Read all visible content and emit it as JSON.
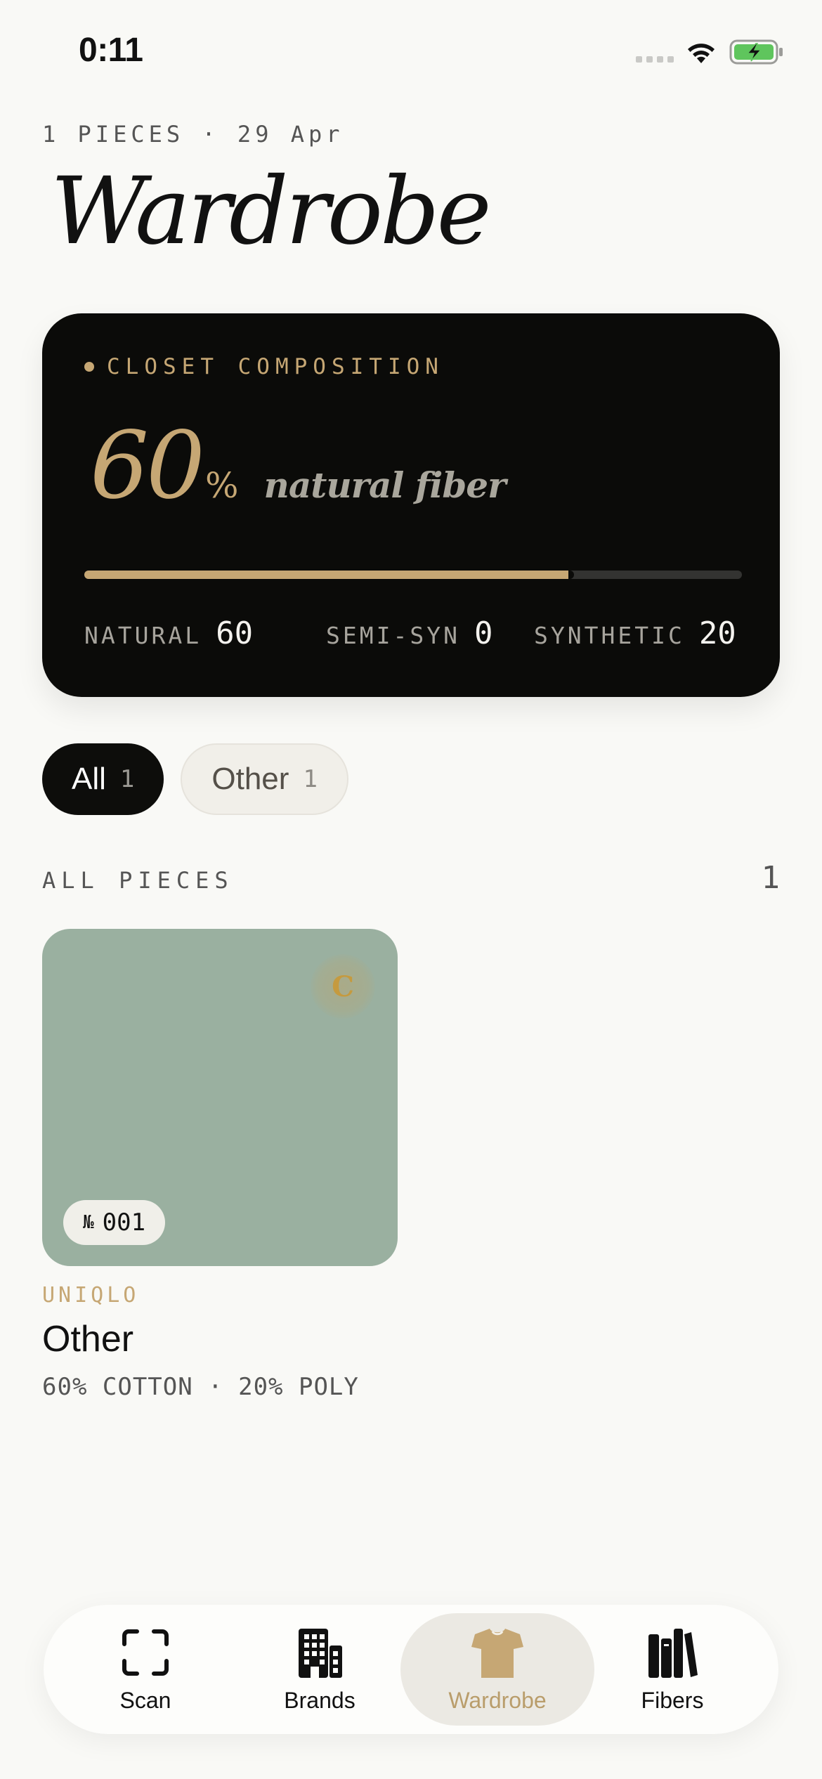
{
  "status_bar": {
    "time": "0:11"
  },
  "header": {
    "meta": "1 PIECES · 29 Apr",
    "title": "Wardrobe"
  },
  "composition": {
    "label": "CLOSET COMPOSITION",
    "percent_value": "60",
    "percent_sign": "%",
    "caption": "natural fiber",
    "natural_fraction": 0.745,
    "stats": [
      {
        "label": "NATURAL",
        "value": "60"
      },
      {
        "label": "SEMI-SYN",
        "value": "0"
      },
      {
        "label": "SYNTHETIC",
        "value": "20"
      }
    ],
    "colors": {
      "accent": "#c6a774",
      "card": "#0b0b09",
      "track": "#333331"
    }
  },
  "filters": [
    {
      "label": "All",
      "count": "1",
      "active": true
    },
    {
      "label": "Other",
      "count": "1",
      "active": false
    }
  ],
  "section": {
    "label": "ALL PIECES",
    "count": "1"
  },
  "items": [
    {
      "badge": "C",
      "number_sign": "№",
      "number": "001",
      "brand": "UNIQLO",
      "name": "Other",
      "composition": "60% COTTON · 20% POLY",
      "swatch_color": "#9ab0a0"
    }
  ],
  "tab_bar": {
    "tabs": [
      {
        "label": "Scan",
        "icon": "scan-icon",
        "active": false
      },
      {
        "label": "Brands",
        "icon": "building-icon",
        "active": false
      },
      {
        "label": "Wardrobe",
        "icon": "tshirt-icon",
        "active": true
      },
      {
        "label": "Fibers",
        "icon": "books-icon",
        "active": false
      }
    ]
  }
}
